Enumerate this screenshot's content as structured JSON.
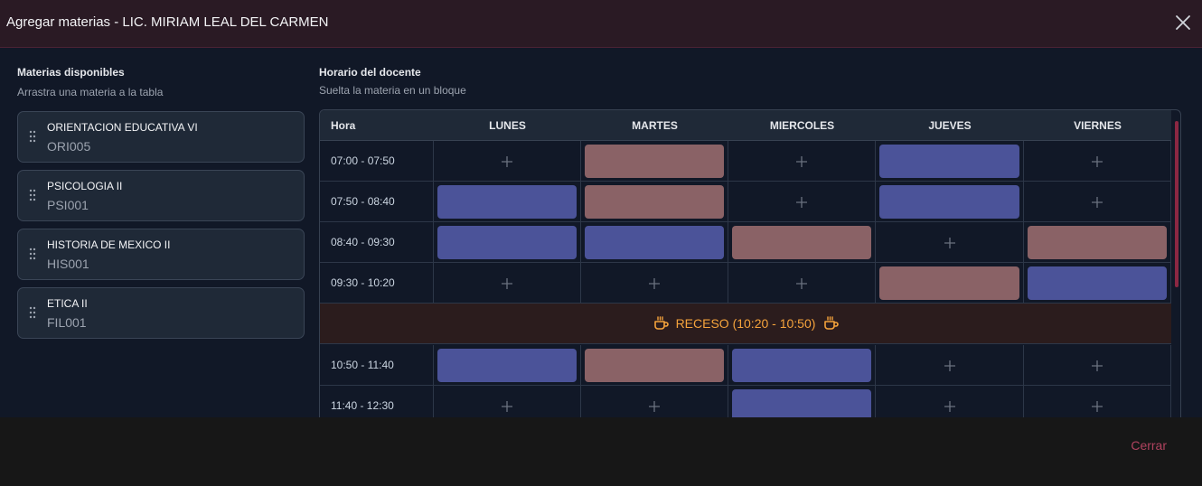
{
  "header": {
    "title": "Agregar materias - LIC. MIRIAM LEAL DEL CARMEN"
  },
  "available": {
    "title": "Materias disponibles",
    "subtitle": "Arrastra una materia a la tabla",
    "items": [
      {
        "name": "ORIENTACION EDUCATIVA VI",
        "code": "ORI005"
      },
      {
        "name": "PSICOLOGIA II",
        "code": "PSI001"
      },
      {
        "name": "HISTORIA DE MEXICO II",
        "code": "HIS001"
      },
      {
        "name": "ETICA II",
        "code": "FIL001"
      }
    ]
  },
  "schedule": {
    "title": "Horario del docente",
    "subtitle": "Suelta la materia en un bloque",
    "headers": [
      "Hora",
      "LUNES",
      "MARTES",
      "MIERCOLES",
      "JUEVES",
      "VIERNES"
    ],
    "recess_label": "RECESO (10:20 - 10:50)",
    "rows": [
      {
        "time": "07:00 - 07:50",
        "cells": [
          "empty",
          "rose",
          "empty",
          "blue",
          "empty"
        ]
      },
      {
        "time": "07:50 - 08:40",
        "cells": [
          "blue",
          "rose",
          "empty",
          "blue",
          "empty"
        ]
      },
      {
        "time": "08:40 - 09:30",
        "cells": [
          "blue",
          "blue",
          "rose",
          "empty",
          "rose"
        ]
      },
      {
        "time": "09:30 - 10:20",
        "cells": [
          "empty",
          "empty",
          "empty",
          "rose",
          "blue"
        ]
      },
      {
        "time": "10:50 - 11:40",
        "cells": [
          "blue",
          "rose",
          "blue",
          "empty",
          "empty"
        ]
      },
      {
        "time": "11:40 - 12:30",
        "cells": [
          "empty",
          "empty",
          "blue",
          "empty",
          "empty"
        ]
      }
    ]
  },
  "footer": {
    "close_label": "Cerrar"
  },
  "icons": {
    "close": "close-icon",
    "drag": "drag-handle-icon",
    "add": "plus-icon",
    "coffee": "coffee-icon"
  },
  "colors": {
    "blue_block": "#4b5399",
    "rose_block": "#8a6266",
    "accent": "#b0435f",
    "recess_text": "#f5a33c"
  }
}
